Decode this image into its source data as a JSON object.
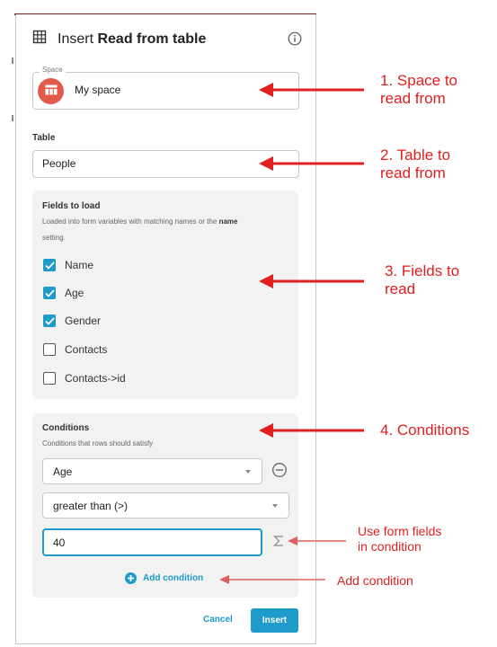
{
  "dialog": {
    "title_prefix": "Insert",
    "title_bold": "Read from table",
    "space": {
      "legend": "Space",
      "value": "My space"
    },
    "table": {
      "label": "Table",
      "value": "People"
    },
    "fields_to_load": {
      "title": "Fields to load",
      "description_before": "Loaded into form variables with matching names or the",
      "description_bold": "name",
      "description_after": "setting.",
      "items": [
        {
          "label": "Name",
          "checked": true
        },
        {
          "label": "Age",
          "checked": true
        },
        {
          "label": "Gender",
          "checked": true
        },
        {
          "label": "Contacts",
          "checked": false
        },
        {
          "label": "Contacts->id",
          "checked": false
        }
      ]
    },
    "conditions": {
      "title": "Conditions",
      "description": "Conditions that rows should satisfy",
      "field_value": "Age",
      "operator_value": "greater than (>)",
      "comparison_value": "40",
      "add_label": "Add condition"
    },
    "buttons": {
      "cancel": "Cancel",
      "insert": "Insert"
    }
  },
  "annotations": {
    "space_1": "1. Space to",
    "space_2": "read from",
    "table_1": "2. Table to",
    "table_2": "read from",
    "fields_1": "3. Fields to",
    "fields_2": "read",
    "conditions": "4. Conditions",
    "form_fields_1": "Use form fields",
    "form_fields_2": "in condition",
    "add_condition": "Add condition"
  },
  "colors": {
    "accent": "#1e9bc9",
    "annotation": "#e02020",
    "space_avatar": "#e35a4b"
  },
  "icons": [
    "table-grid-icon",
    "info-icon",
    "table-icon",
    "check-icon",
    "remove-circle-icon",
    "sigma-icon",
    "plus-circle-icon"
  ]
}
